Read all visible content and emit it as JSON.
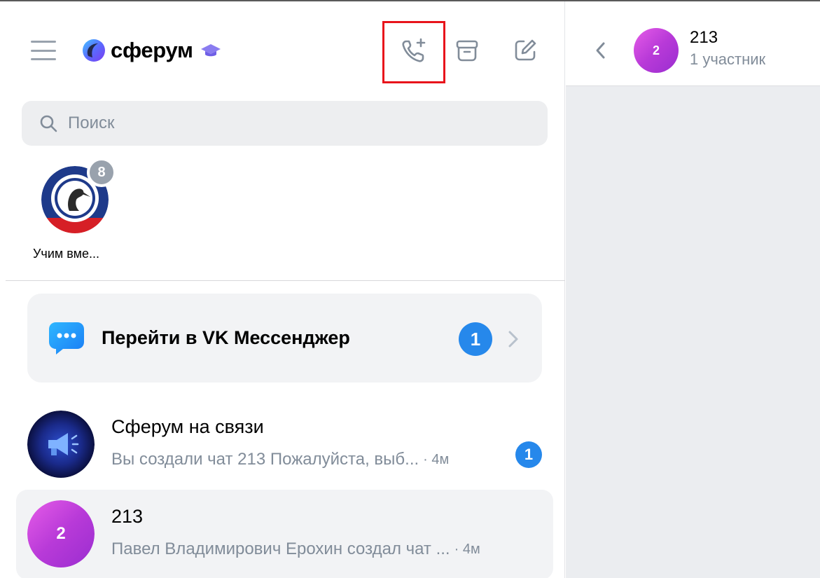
{
  "app": {
    "brand_name": "сферум"
  },
  "icons": {
    "menu": "hamburger-menu-icon",
    "logo": "sferum-logo-icon",
    "cap": "graduation-cap-icon",
    "call": "add-call-icon",
    "archive": "archive-box-icon",
    "compose": "compose-edit-icon",
    "search": "search-icon",
    "vk": "vk-messenger-icon",
    "chevron": "chevron-right-icon",
    "back": "chevron-left-icon",
    "megaphone": "megaphone-icon"
  },
  "search": {
    "placeholder": "Поиск"
  },
  "stories": [
    {
      "label": "Учим вме...",
      "count": "8"
    }
  ],
  "vk_banner": {
    "label": "Перейти в VK Мессенджер",
    "count": "1"
  },
  "chats": [
    {
      "title": "Сферум на связи",
      "preview": "Вы создали чат 213 Пожалуйста, выб...",
      "time": "· 4м",
      "unread": "1"
    },
    {
      "title": "213",
      "avatar_text": "2",
      "preview": "Павел Владимирович Ерохин создал чат ...",
      "time": "· 4м"
    }
  ],
  "conversation": {
    "title": "213",
    "subtitle": "1 участник",
    "avatar_text": "2"
  },
  "colors": {
    "accent": "#2688eb",
    "secondary_text": "#818c99",
    "highlight_box": "#e8141b",
    "group_avatar": "#c13fdc"
  }
}
